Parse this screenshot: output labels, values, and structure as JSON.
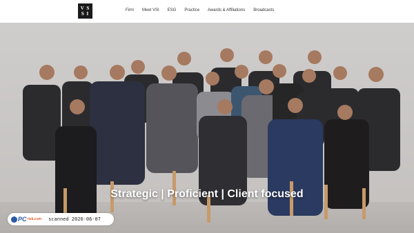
{
  "logo": {
    "line1": "V S",
    "line2": "S I"
  },
  "nav": {
    "items": [
      "Firm",
      "Meet VSI",
      "ESG",
      "Practice",
      "Awards & Affiliations",
      "Broadcasts"
    ]
  },
  "hero": {
    "tagline": "Strategic | Proficient | Client focused"
  },
  "badge": {
    "brand": "PC",
    "brand_suffix": "risk.com",
    "scan_text": "scanned 2026-06-07"
  },
  "colors": {
    "logo_bg": "#1b1b1b",
    "hero_bg": "#cfcdcc",
    "badge_brand": "#2a5aa8"
  }
}
